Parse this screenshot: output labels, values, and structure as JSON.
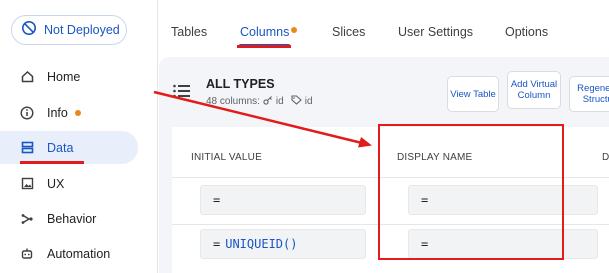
{
  "deploy": {
    "label": "Not Deployed"
  },
  "nav": {
    "items": [
      {
        "label": "Home",
        "icon": "home-icon"
      },
      {
        "label": "Info",
        "icon": "info-icon"
      },
      {
        "label": "Data",
        "icon": "data-icon"
      },
      {
        "label": "UX",
        "icon": "image-icon"
      },
      {
        "label": "Behavior",
        "icon": "behavior-icon"
      },
      {
        "label": "Automation",
        "icon": "automation-icon"
      }
    ]
  },
  "tabs": [
    {
      "label": "Tables"
    },
    {
      "label": "Columns"
    },
    {
      "label": "Slices"
    },
    {
      "label": "User Settings"
    },
    {
      "label": "Options"
    }
  ],
  "table": {
    "title": "ALL TYPES",
    "meta_columns": "48 columns:",
    "meta_key1": "id",
    "meta_key2": "id"
  },
  "buttons": {
    "view_table": "View Table",
    "add_virtual_column": "Add Virtual Column",
    "regenerate_structure": "Regenerate Structure"
  },
  "grid": {
    "headers": {
      "initial_value": "INITIAL VALUE",
      "display_name": "DISPLAY NAME",
      "partial": "D"
    },
    "rows": [
      {
        "initial_eq": "=",
        "initial_fn": "",
        "display_eq": "="
      },
      {
        "initial_eq": "=",
        "initial_fn": "UNIQUEID()",
        "display_eq": "="
      }
    ]
  },
  "colors": {
    "accent": "#1a56c4",
    "annotation": "#e21b1b",
    "badge": "#e8891e"
  }
}
